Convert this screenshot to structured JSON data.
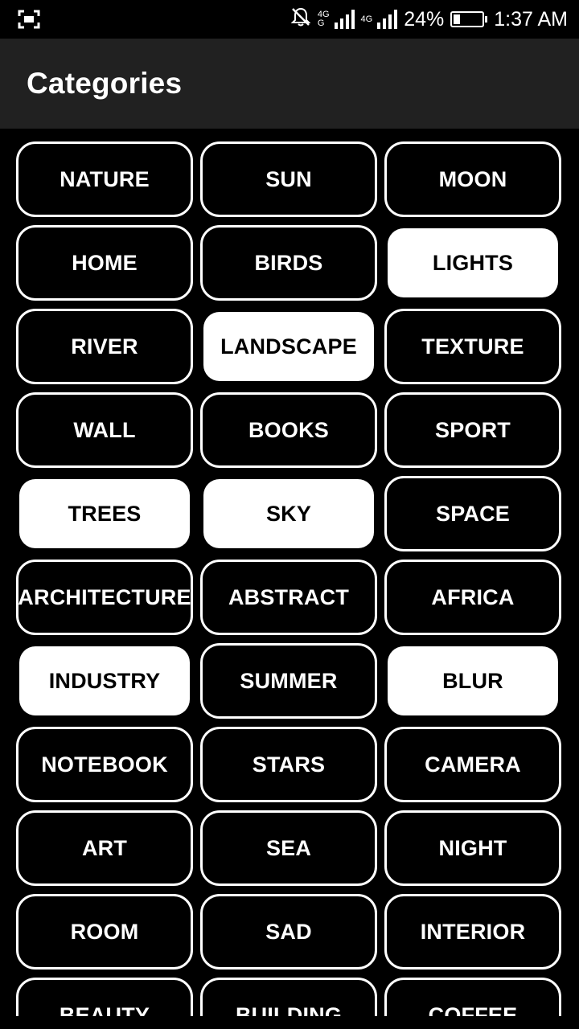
{
  "status_bar": {
    "left_icon": "screenshot-frame-icon",
    "mute_icon": "notifications-off-icon",
    "sim1_label": "4G",
    "sim1_sub": "G",
    "sim2_label": "4G",
    "battery_percent": "24%",
    "battery_level": 0.24,
    "time": "1:37 AM"
  },
  "app_bar": {
    "title": "Categories"
  },
  "categories": [
    {
      "label": "NATURE",
      "selected": false
    },
    {
      "label": "SUN",
      "selected": false
    },
    {
      "label": "MOON",
      "selected": false
    },
    {
      "label": "HOME",
      "selected": false
    },
    {
      "label": "BIRDS",
      "selected": false
    },
    {
      "label": "LIGHTS",
      "selected": true
    },
    {
      "label": "RIVER",
      "selected": false
    },
    {
      "label": "LANDSCAPE",
      "selected": true
    },
    {
      "label": "TEXTURE",
      "selected": false
    },
    {
      "label": "WALL",
      "selected": false
    },
    {
      "label": "BOOKS",
      "selected": false
    },
    {
      "label": "SPORT",
      "selected": false
    },
    {
      "label": "TREES",
      "selected": true
    },
    {
      "label": "SKY",
      "selected": true
    },
    {
      "label": "SPACE",
      "selected": false
    },
    {
      "label": "ARCHITECTURE",
      "selected": false
    },
    {
      "label": "ABSTRACT",
      "selected": false
    },
    {
      "label": "AFRICA",
      "selected": false
    },
    {
      "label": "INDUSTRY",
      "selected": true
    },
    {
      "label": "SUMMER",
      "selected": false
    },
    {
      "label": "BLUR",
      "selected": true
    },
    {
      "label": "NOTEBOOK",
      "selected": false
    },
    {
      "label": "STARS",
      "selected": false
    },
    {
      "label": "CAMERA",
      "selected": false
    },
    {
      "label": "ART",
      "selected": false
    },
    {
      "label": "SEA",
      "selected": false
    },
    {
      "label": "NIGHT",
      "selected": false
    },
    {
      "label": "ROOM",
      "selected": false
    },
    {
      "label": "SAD",
      "selected": false
    },
    {
      "label": "INTERIOR",
      "selected": false
    },
    {
      "label": "BEAUTY",
      "selected": false
    },
    {
      "label": "BUILDING",
      "selected": false
    },
    {
      "label": "COFFEE",
      "selected": false
    }
  ]
}
